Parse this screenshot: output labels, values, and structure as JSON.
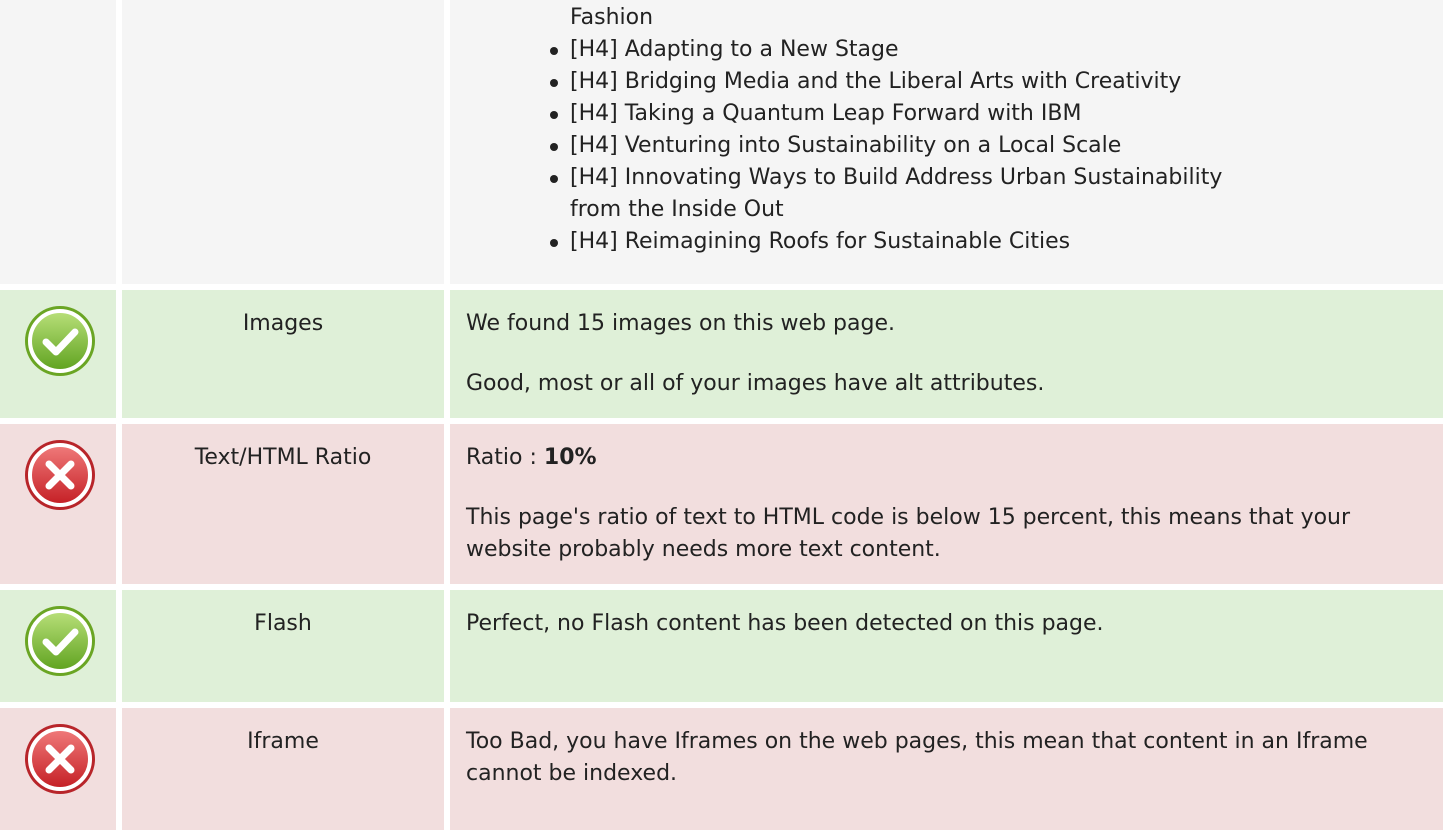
{
  "headings_row": {
    "items": [
      {
        "text": "Fashion",
        "bullet": false
      },
      {
        "text": "[H4] Adapting to a New Stage",
        "bullet": true
      },
      {
        "text": "[H4] Bridging Media and the Liberal Arts with Creativity",
        "bullet": true
      },
      {
        "text": "[H4] Taking a Quantum Leap Forward with IBM",
        "bullet": true
      },
      {
        "text": "[H4] Venturing into Sustainability on a Local Scale",
        "bullet": true
      },
      {
        "text": "[H4] Innovating Ways to Build Address Urban Sustainability",
        "bullet": true
      },
      {
        "text": "from the Inside Out",
        "bullet": false
      },
      {
        "text": "[H4] Reimagining Roofs for Sustainable Cities",
        "bullet": true
      }
    ]
  },
  "images_row": {
    "status": "good",
    "icon": "check-icon",
    "label": "Images",
    "line1": "We found 15 images on this web page.",
    "line2": "Good, most or all of your images have alt attributes."
  },
  "ratio_row": {
    "status": "bad",
    "icon": "error-icon",
    "label": "Text/HTML Ratio",
    "ratio_prefix": "Ratio : ",
    "ratio_value": "10%",
    "line2": "This page's ratio of text to HTML code is below 15 percent, this means that your website probably needs more text content."
  },
  "flash_row": {
    "status": "good",
    "icon": "check-icon",
    "label": "Flash",
    "line1": "Perfect, no Flash content has been detected on this page."
  },
  "iframe_row": {
    "status": "bad",
    "icon": "error-icon",
    "label": "Iframe",
    "line1": "Too Bad, you have Iframes on the web pages, this mean that content in an Iframe cannot be indexed."
  },
  "colors": {
    "good_bg": "#dff0d8",
    "bad_bg": "#f2dede",
    "neutral_bg": "#f5f5f5",
    "check_green": "#8cc63f",
    "error_red": "#e0393e"
  }
}
